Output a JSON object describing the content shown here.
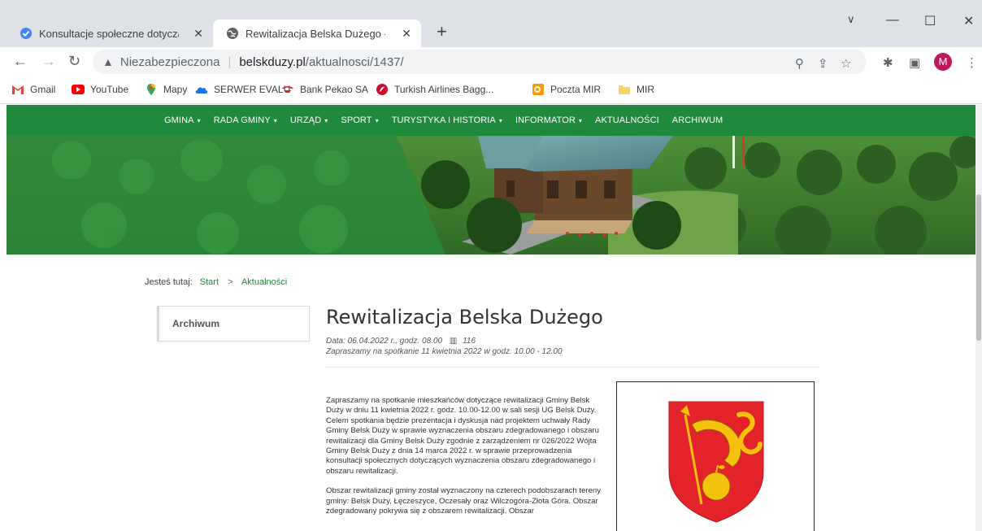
{
  "browser": {
    "tabs": [
      {
        "title": "Konsultacje społeczne dotyczące wy",
        "icon": "google-forms-check-icon"
      },
      {
        "title": "Rewitalizacja Belska Dużego - Gmin",
        "icon": "globe-icon"
      }
    ],
    "new_tab_symbol": "+",
    "window_controls": {
      "dropdown": "∨",
      "minimize": "—",
      "maximize": "☐",
      "close": "✕"
    },
    "address": {
      "security_label": "Niezabezpieczona",
      "host": "belskduzy.pl",
      "path": "/aktualnosci/1437/"
    },
    "profile_initial": "M",
    "bookmarks": [
      {
        "label": "Gmail",
        "icon": "gmail-icon"
      },
      {
        "label": "YouTube",
        "icon": "youtube-icon"
      },
      {
        "label": "Mapy",
        "icon": "maps-pin-icon"
      },
      {
        "label": "SERWER EVALU",
        "icon": "cloud-icon"
      },
      {
        "label": "Bank Pekao SA",
        "icon": "pekao-icon"
      },
      {
        "label": "Turkish Airlines Bagg...",
        "icon": "turkish-airlines-icon"
      },
      {
        "label": "Poczta MIR",
        "icon": "outlook-icon"
      },
      {
        "label": "MIR",
        "icon": "folder-icon"
      }
    ]
  },
  "site": {
    "nav": [
      {
        "label": "GMINA",
        "dropdown": true
      },
      {
        "label": "RADA GMINY",
        "dropdown": true
      },
      {
        "label": "URZĄD",
        "dropdown": true
      },
      {
        "label": "SPORT",
        "dropdown": true
      },
      {
        "label": "TURYSTYKA I HISTORIA",
        "dropdown": true
      },
      {
        "label": "INFORMATOR",
        "dropdown": true
      },
      {
        "label": "AKTUALNOŚCI",
        "dropdown": false
      },
      {
        "label": "ARCHIWUM",
        "dropdown": false
      }
    ],
    "breadcrumb": {
      "prefix": "Jesteś tutaj:",
      "items": [
        "Start",
        "Aktualności"
      ],
      "separator": ">"
    },
    "sidebar": {
      "archive_label": "Archiwum"
    },
    "article": {
      "title": "Rewitalizacja Belska Dużego",
      "date_line": "Data: 06.04.2022 r., godz. 08.00",
      "views": "116",
      "lead": "Zapraszamy na spotkanie 11 kwietnia 2022 w godz. 10.00 - 12.00",
      "paragraph1": "Zapraszamy na spotkanie mieszkańców dotyczące rewitalizacji Gminy Belsk Duży w dniu 11 kwietnia 2022 r. godz. 10.00-12.00 w sali sesji UG Belsk Duży. Celem spotkania będzie prezentacja i dyskusja nad projektem uchwały Rady Gminy Belsk Duży w sprawie wyznaczenia obszaru zdegradowanego i obszaru rewitalizacji dla Gminy Belsk Duży zgodnie z zarządzeniem nr 026/2022 Wójta Gminy Belsk Duży z dnia 14 marca 2022 r. w sprawie przeprowadzenia konsultacji społecznych dotyczących wyznaczenia obszaru zdegradowanego i obszaru rewitalizacji.",
      "paragraph2": "Obszar rewitalizacji gminy został wyznaczony na czterech podobszarach tereny gminy: Belsk Duży, Łęczeszyce, Oczesały oraz Wilczogóra-Złota Góra. Obszar zdegradowany pokrywa się z obszarem rewitalizacji. Obszar"
    }
  },
  "colors": {
    "nav_green": "#1f8a3c",
    "tab_strip": "#dee1e6",
    "coat_red": "#e3222a",
    "coat_gold": "#f4c20d"
  }
}
